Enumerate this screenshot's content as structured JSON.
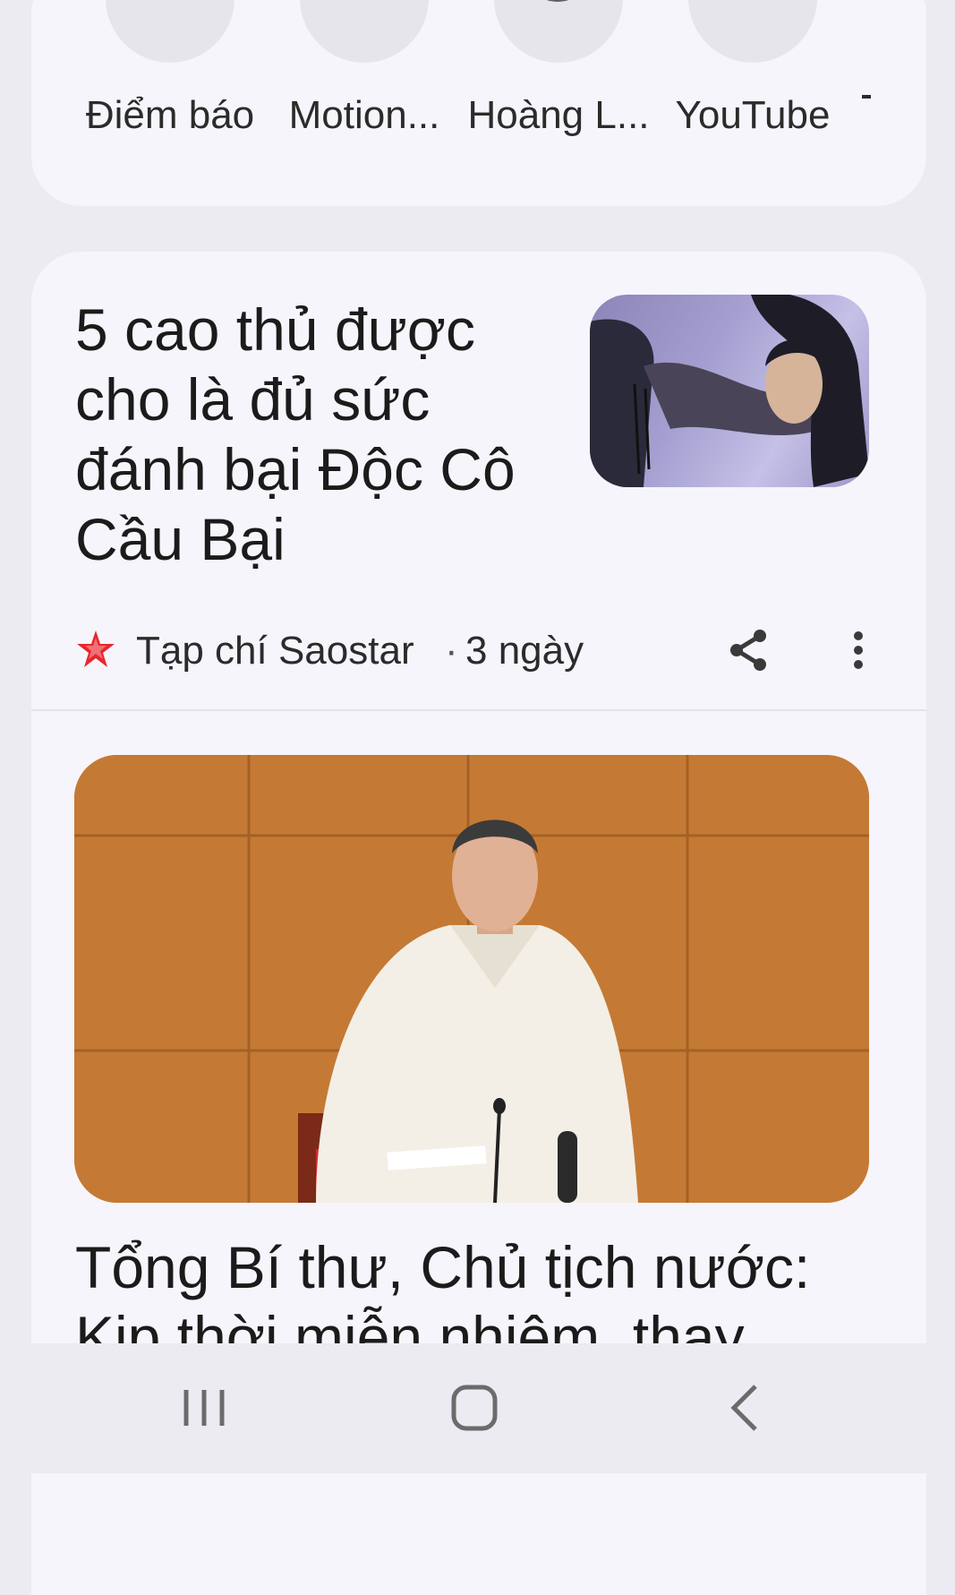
{
  "shortcuts": [
    {
      "label": "Điểm báo",
      "icon": "globe-icon"
    },
    {
      "label": "Motion...",
      "icon": "motion-icon"
    },
    {
      "label": "Hoàng L...",
      "icon": "f-letter-icon",
      "letter": "F"
    },
    {
      "label": "YouTube",
      "icon": "youtube-icon"
    }
  ],
  "articles": [
    {
      "title": "5 cao thủ được cho là đủ sức đánh bại Độc Cô Cầu Bại",
      "source": "Tạp chí Saostar",
      "separator": "·",
      "age": "3 ngày",
      "source_icon": "red-star-icon"
    },
    {
      "title": "Tổng Bí thư, Chủ tịch nước: Kịp thời miễn nhiệm, thay"
    }
  ],
  "colors": {
    "background": "#ecebf1",
    "card": "#f6f5fb",
    "youtube_red": "#ff0033",
    "saostar_red": "#e8262c"
  },
  "navbar": {
    "recents_icon": "recents-icon",
    "home_icon": "home-icon",
    "back_icon": "back-icon"
  }
}
